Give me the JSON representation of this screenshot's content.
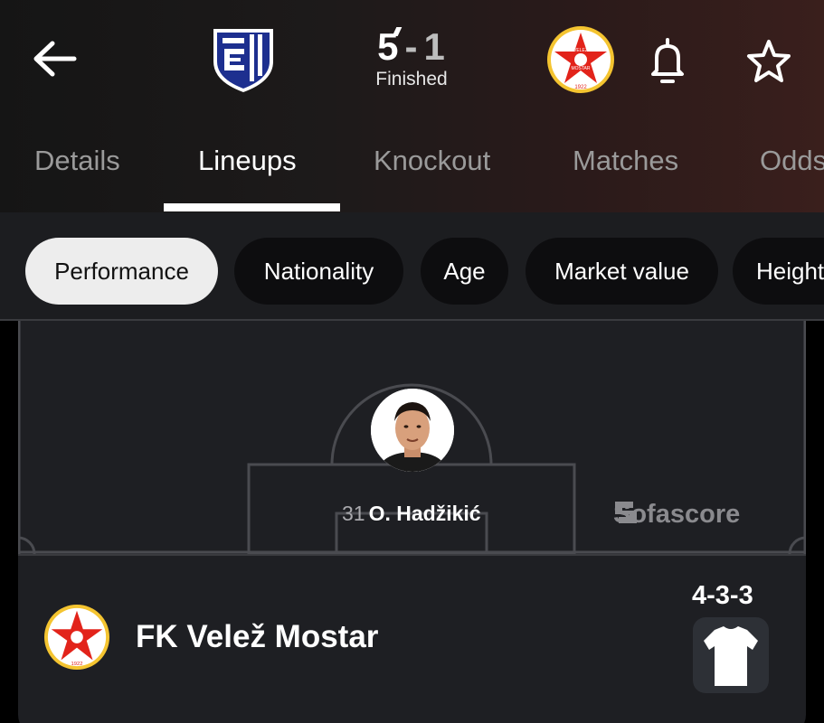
{
  "header": {
    "home_team_logo": "Inter Club d'Escaldes crest",
    "away_team_logo": "FK Velez Mostar crest",
    "away_logo_text": {
      "top": "VELEŽ",
      "bottom": "MOSTAR",
      "year": "1922"
    },
    "score": {
      "home": "5",
      "separator": "-",
      "away": "1"
    },
    "status": "Finished",
    "icons": {
      "back": "arrow-left-icon",
      "bell": "bell-icon",
      "favorite": "star-icon"
    }
  },
  "tabs": [
    {
      "label": "Details",
      "active": false
    },
    {
      "label": "Lineups",
      "active": true
    },
    {
      "label": "Knockout",
      "active": false
    },
    {
      "label": "Matches",
      "active": false
    },
    {
      "label": "Odds",
      "active": false
    }
  ],
  "filters": [
    {
      "label": "Performance",
      "active": true
    },
    {
      "label": "Nationality",
      "active": false
    },
    {
      "label": "Age",
      "active": false
    },
    {
      "label": "Market value",
      "active": false
    },
    {
      "label": "Height",
      "active": false
    }
  ],
  "pitch": {
    "watermark": "Sofascore",
    "player": {
      "number": "31",
      "name": "O. Hadžikić"
    }
  },
  "team": {
    "name": "FK Velež Mostar",
    "formation": "4-3-3",
    "kit_icon": "shirt-icon"
  },
  "colors": {
    "accent_red": "#e2231a",
    "inter_blue": "#1d2f8f",
    "velez_yellow": "#f4c430"
  }
}
